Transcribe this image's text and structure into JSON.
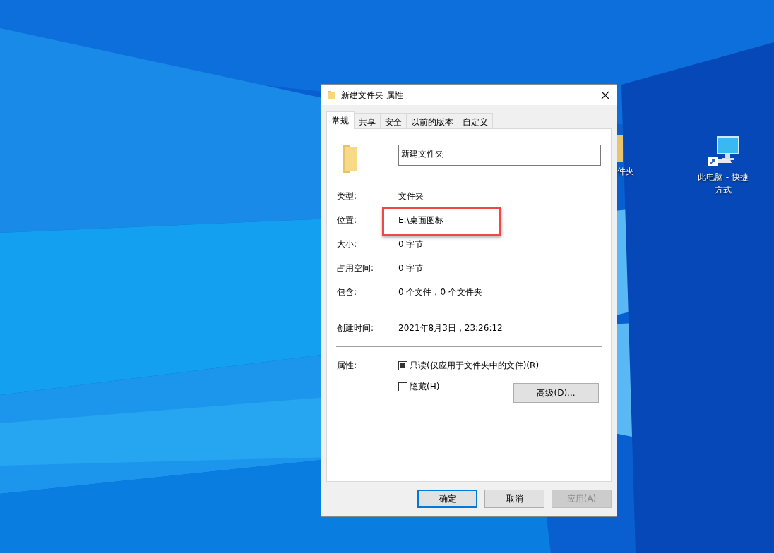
{
  "desktop_icons": [
    {
      "kind": "folder",
      "label": "件夹"
    },
    {
      "kind": "computer",
      "label": "此电脑 - 快捷方式"
    }
  ],
  "window": {
    "title": "新建文件夹 属性"
  },
  "tabs": [
    {
      "label": "常规",
      "selected": true
    },
    {
      "label": "共享",
      "selected": false
    },
    {
      "label": "安全",
      "selected": false
    },
    {
      "label": "以前的版本",
      "selected": false
    },
    {
      "label": "自定义",
      "selected": false
    }
  ],
  "name_field": {
    "value": "新建文件夹"
  },
  "sections": [
    {
      "rows": [
        {
          "label": "类型:",
          "value": "文件夹",
          "highlighted": false
        },
        {
          "label": "位置:",
          "value": "E:\\桌面图标",
          "highlighted": true
        },
        {
          "label": "大小:",
          "value": "0 字节",
          "highlighted": false
        },
        {
          "label": "占用空间:",
          "value": "0 字节",
          "highlighted": false
        },
        {
          "label": "包含:",
          "value": "0 个文件，0 个文件夹",
          "highlighted": false
        }
      ]
    },
    {
      "rows": [
        {
          "label": "创建时间:",
          "value": "2021年8月3日，23:26:12",
          "highlighted": false
        }
      ]
    }
  ],
  "attributes": {
    "label": "属性:",
    "checkboxes": [
      {
        "label": "只读(仅应用于文件夹中的文件)(R)",
        "checked": false,
        "indeterminate": true
      },
      {
        "label": "隐藏(H)",
        "checked": false,
        "indeterminate": false
      }
    ],
    "advanced_button": "高级(D)..."
  },
  "buttons": [
    {
      "label": "确定",
      "default": true,
      "disabled": false
    },
    {
      "label": "取消",
      "default": false,
      "disabled": false
    },
    {
      "label": "应用(A)",
      "default": false,
      "disabled": true
    }
  ]
}
